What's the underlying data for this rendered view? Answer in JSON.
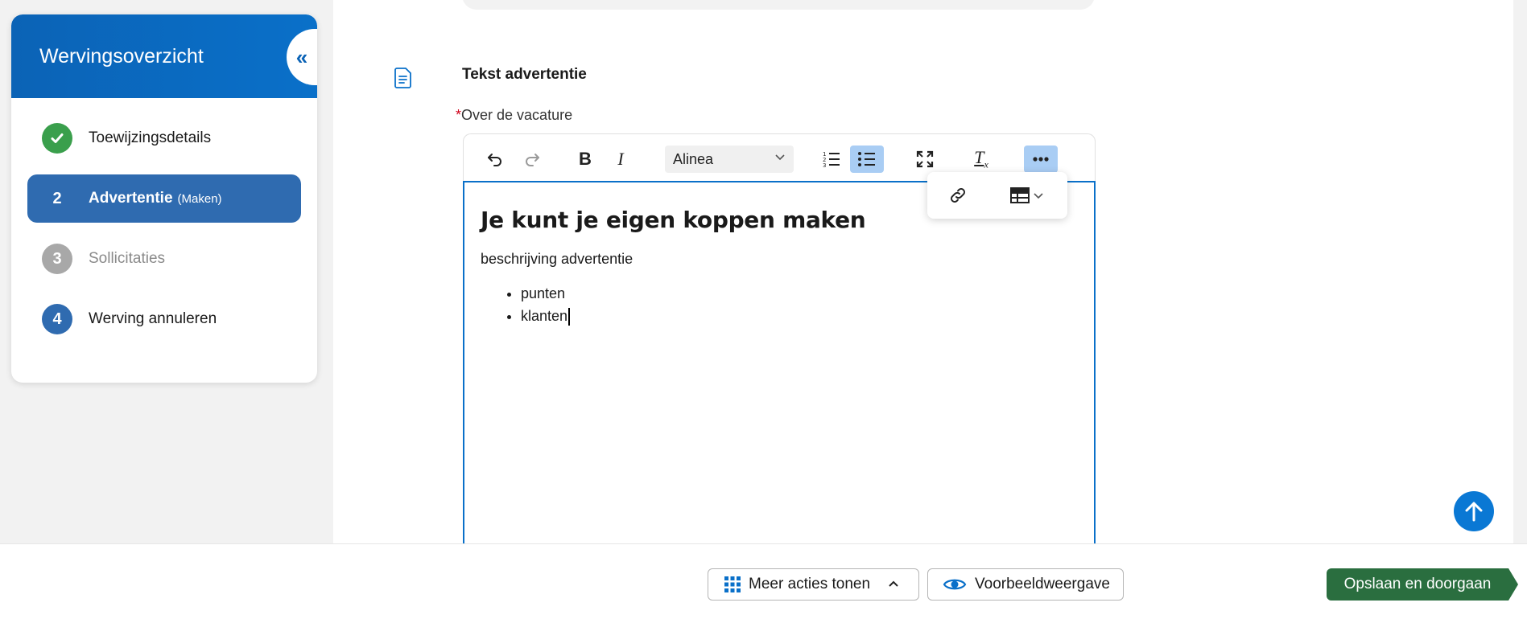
{
  "sidebar": {
    "title": "Wervingsoverzicht",
    "collapse_icon": "chevrons-left-icon",
    "items": [
      {
        "badge": "",
        "label": "Toewijzingsdetails",
        "sub": "",
        "state": "done"
      },
      {
        "badge": "2",
        "label": "Advertentie",
        "sub": "(Maken)",
        "state": "active"
      },
      {
        "badge": "3",
        "label": "Sollicitaties",
        "sub": "",
        "state": "disabled"
      },
      {
        "badge": "4",
        "label": "Werving annuleren",
        "sub": "",
        "state": "normal"
      }
    ]
  },
  "section": {
    "title": "Tekst advertentie",
    "field_required_mark": "*",
    "field_label": "Over de vacature"
  },
  "toolbar": {
    "block_format": "Alinea",
    "icons": [
      "undo-icon",
      "redo-icon",
      "bold-icon",
      "italic-icon",
      "numbered-list-icon",
      "bullet-list-icon",
      "fullscreen-icon",
      "clear-format-icon",
      "more-icon"
    ],
    "popover_icons": [
      "link-icon",
      "table-icon"
    ]
  },
  "editor": {
    "heading": "Je kunt je eigen koppen maken",
    "paragraph": "beschrijving advertentie",
    "bullets": [
      "punten",
      "klanten"
    ]
  },
  "footer": {
    "more_actions": "Meer acties tonen",
    "preview": "Voorbeeldweergave",
    "save": "Opslaan en doorgaan"
  },
  "colors": {
    "brand_blue": "#0a70c9",
    "active_step": "#2f6bb0",
    "done_green": "#3a9f4c",
    "save_green": "#2a6e3f",
    "toggle_on": "#a9cdf4"
  }
}
